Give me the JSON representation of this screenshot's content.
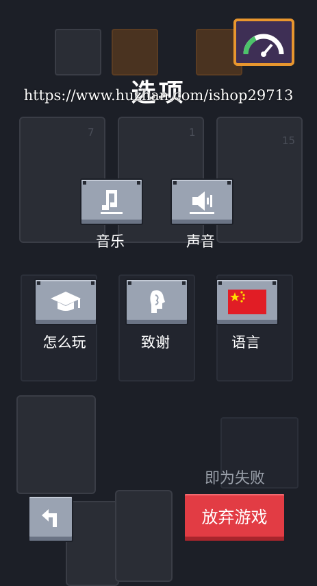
{
  "header": {
    "title": "选项",
    "watermark": "https://www.huzhan.com/ishop29713",
    "speed_icon": "speedometer-icon"
  },
  "options": {
    "music": {
      "label": "音乐",
      "icon": "music-note-icon"
    },
    "sound": {
      "label": "声音",
      "icon": "speaker-icon"
    },
    "how_to_play": {
      "label": "怎么玩",
      "icon": "graduation-cap-icon"
    },
    "credits": {
      "label": "致谢",
      "icon": "head-profile-icon"
    },
    "language": {
      "label": "语言",
      "icon": "china-flag-icon"
    }
  },
  "background_cards": {
    "values": [
      "7",
      "1",
      "15"
    ]
  },
  "footer": {
    "back_icon": "back-arrow-icon",
    "lose_text": "即为失败",
    "abandon_label": "放弃游戏"
  },
  "colors": {
    "background": "#1c1f27",
    "button": "#9aa3b2",
    "danger": "#e23c44",
    "gauge_border": "#e8962e",
    "gauge_fill": "#3e2f55"
  }
}
